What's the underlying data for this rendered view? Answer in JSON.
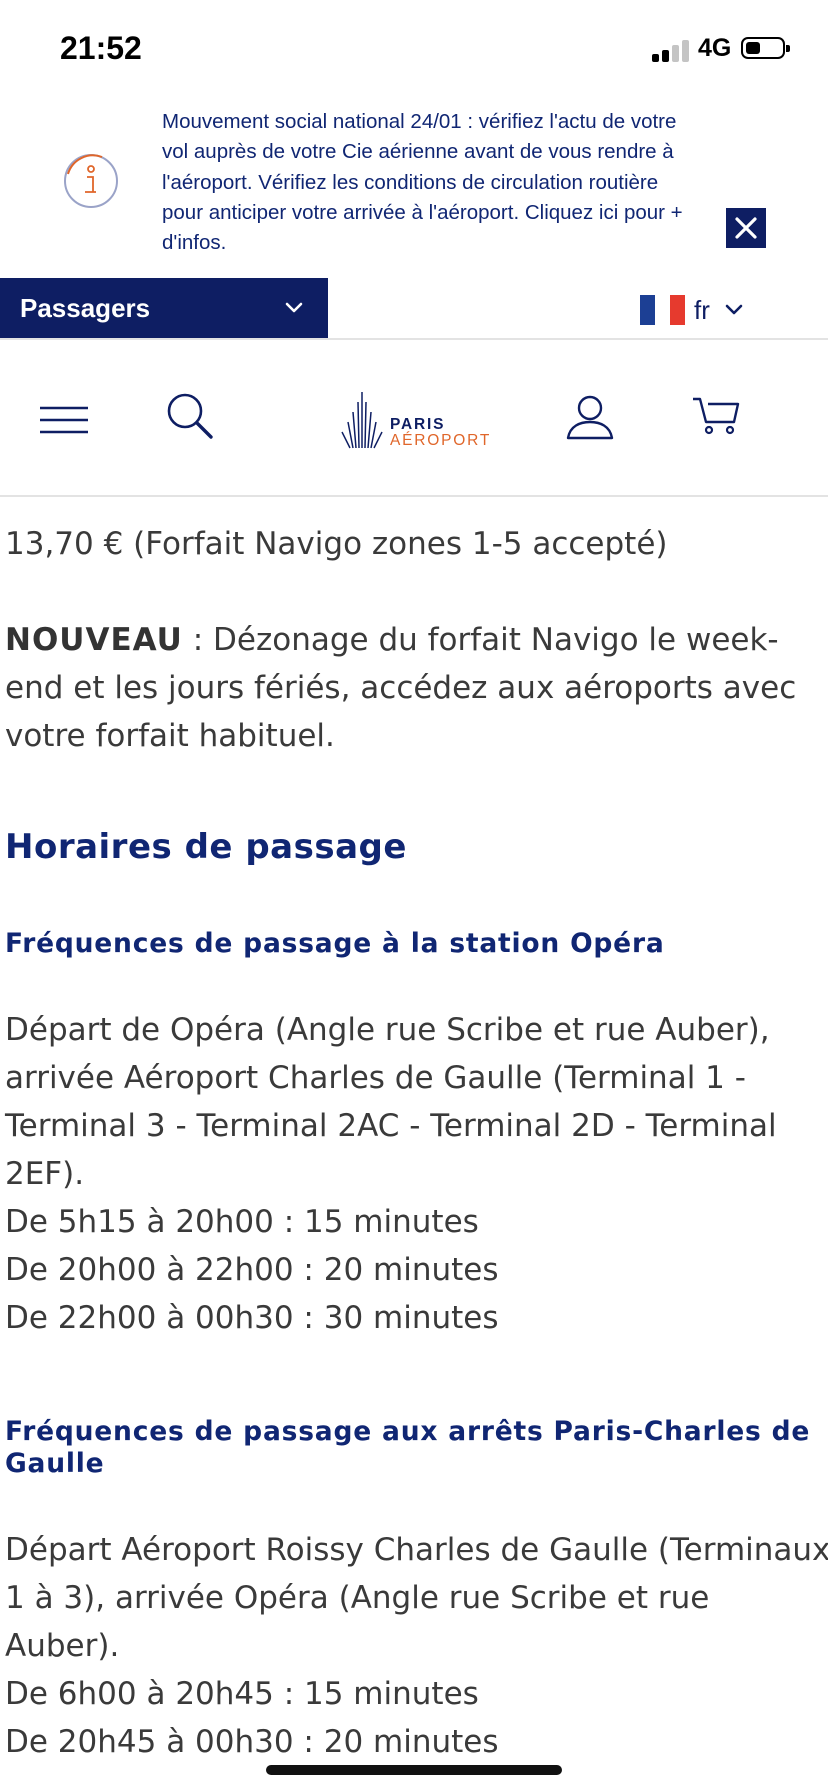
{
  "status_bar": {
    "time": "21:52",
    "network": "4G",
    "signal_bars_active": 2,
    "signal_bars_total": 4,
    "battery_fraction": 0.3
  },
  "alert": {
    "icon": "info-icon",
    "text": "Mouvement social national 24/01 : vérifiez l'actu de votre vol auprès de votre Cie aérienne avant de vous rendre à l'aéroport. Vérifiez les conditions de circulation routière pour anticiper votre arrivée à l'aéroport. Cliquez ici pour + d'infos.",
    "close_symbol": "✕",
    "color": "#102673"
  },
  "audience": {
    "label": "Passagers",
    "icon": "chevron-down-icon",
    "background": "#0e1e63"
  },
  "language": {
    "label": "fr",
    "flag_colors": [
      "#1c3f94",
      "#ffffff",
      "#e63a2e"
    ]
  },
  "nav": {
    "logo_line1": "PARIS",
    "logo_line2": "AÉROPORT",
    "icons": [
      "menu-icon",
      "search-icon",
      "account-icon",
      "cart-icon"
    ],
    "brand_orange": "#e0662a"
  },
  "content": {
    "price_line": "13,70 € (Forfait Navigo zones 1-5 accepté)",
    "nouveau_label": "NOUVEAU",
    "nouveau_text": " : Dézonage du forfait Navigo le week-end et les jours fériés, accédez aux aéroports avec votre forfait habituel.",
    "section_title": "Horaires de passage",
    "opera": {
      "title": "Fréquences de passage à la station Opéra",
      "route": "Départ de Opéra (Angle rue Scribe et rue Auber), arrivée Aéroport Charles de Gaulle (Terminal 1 - Terminal 3 - Terminal 2AC - Terminal 2D - Terminal 2EF).",
      "schedule": [
        "De 5h15 à 20h00 : 15 minutes",
        "De 20h00 à 22h00 : 20 minutes",
        "De 22h00 à 00h30 : 30 minutes"
      ]
    },
    "cdg": {
      "title": "Fréquences de passage aux arrêts Paris-Charles de Gaulle",
      "route": "Départ Aéroport Roissy Charles de Gaulle (Terminaux 1 à 3), arrivée Opéra (Angle rue Scribe et rue Auber).",
      "schedule": [
        "De 6h00 à 20h45 : 15 minutes",
        "De 20h45 à 00h30 : 20 minutes"
      ]
    }
  }
}
